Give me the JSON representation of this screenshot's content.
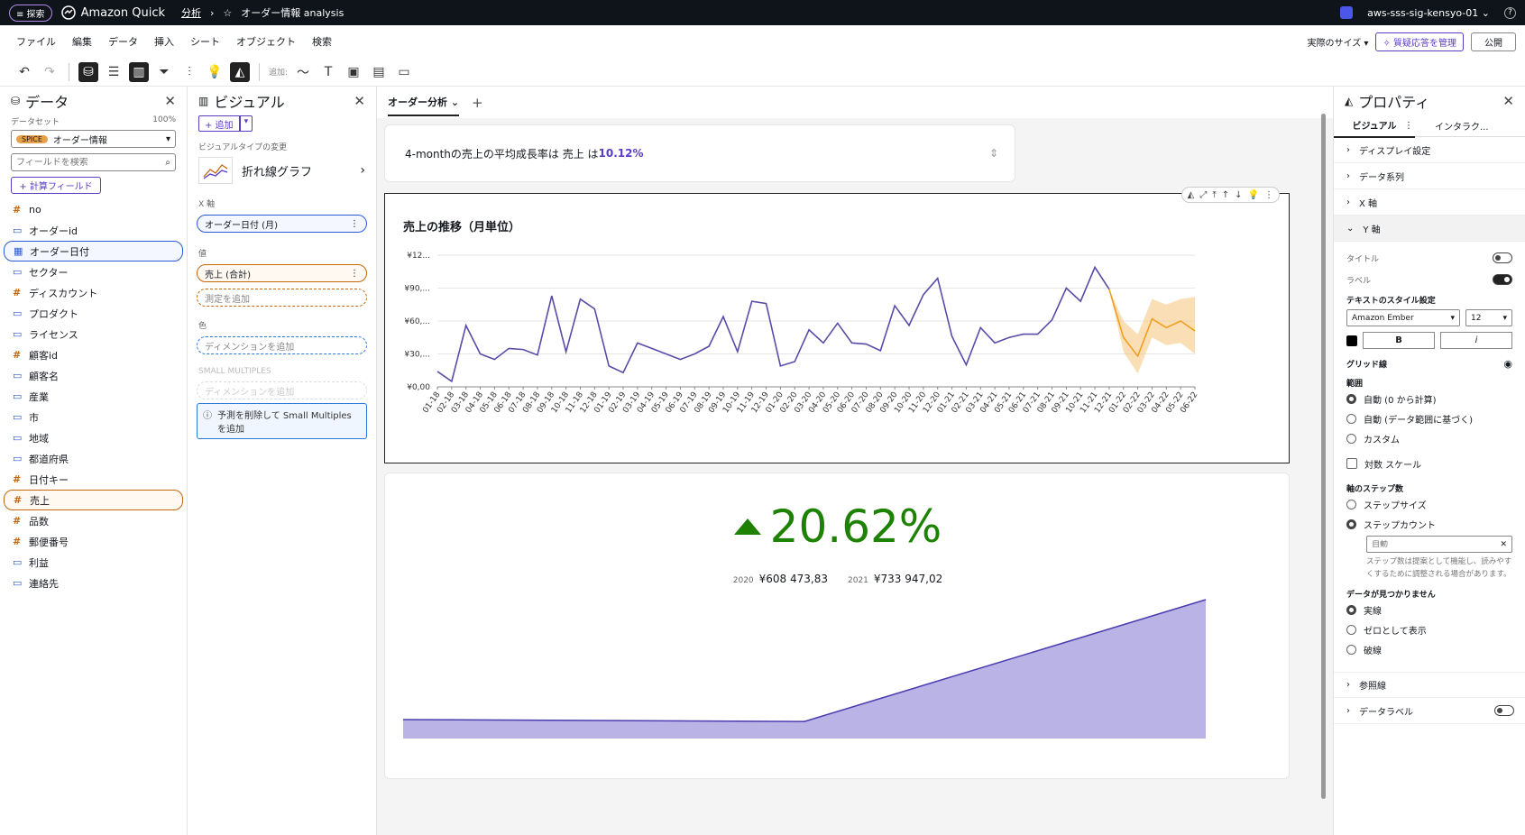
{
  "topbar": {
    "explore": "≡ 探索",
    "app": "Amazon Quick",
    "crumb1": "分析",
    "crumb2": "オーダー情報 analysis",
    "account": "aws-sss-sig-kensyo-01 ⌄",
    "help": "?"
  },
  "menu": [
    "ファイル",
    "編集",
    "データ",
    "挿入",
    "シート",
    "オブジェクト",
    "検索"
  ],
  "menu_right": {
    "size": "実際のサイズ ▾",
    "qa": "✧ 質疑応答を管理",
    "publish": "公開"
  },
  "toolbar": {
    "add_label": "追加:"
  },
  "data_panel": {
    "title": "データ",
    "dataset_label": "データセット",
    "dataset_pct": "100%",
    "spice": "SPICE",
    "dataset": "オーダー情報",
    "search_placeholder": "フィールドを検索",
    "calc_btn": "+ 計算フィールド",
    "fields": [
      {
        "icon": "#",
        "name": "no"
      },
      {
        "icon": "▭",
        "name": "オーダーid"
      },
      {
        "icon": "▦",
        "name": "オーダー日付"
      },
      {
        "icon": "▭",
        "name": "セクター"
      },
      {
        "icon": "#",
        "name": "ディスカウント"
      },
      {
        "icon": "▭",
        "name": "プロダクト"
      },
      {
        "icon": "▭",
        "name": "ライセンス"
      },
      {
        "icon": "#",
        "name": "顧客id"
      },
      {
        "icon": "▭",
        "name": "顧客名"
      },
      {
        "icon": "▭",
        "name": "産業"
      },
      {
        "icon": "▭",
        "name": "市"
      },
      {
        "icon": "▭",
        "name": "地域"
      },
      {
        "icon": "▭",
        "name": "都道府県"
      },
      {
        "icon": "#",
        "name": "日付キー"
      },
      {
        "icon": "#",
        "name": "売上"
      },
      {
        "icon": "#",
        "name": "品数"
      },
      {
        "icon": "#",
        "name": "郵便番号"
      },
      {
        "icon": "▭",
        "name": "利益"
      },
      {
        "icon": "▭",
        "name": "連絡先"
      }
    ]
  },
  "visual_panel": {
    "title": "ビジュアル",
    "add": "+ 追加",
    "type_label": "ビジュアルタイプの変更",
    "type": "折れ線グラフ",
    "x_label": "X 軸",
    "x_field": "オーダー日付 (月)",
    "value_label": "値",
    "value_field": "売上 (合計)",
    "add_measure": "測定を追加",
    "color_label": "色",
    "add_dim": "ディメンションを追加",
    "sm_label": "SMALL MULTIPLES",
    "sm_dim": "ディメンションを追加",
    "info": "予測を削除して Small Multiples を追加"
  },
  "sheet": {
    "tab": "オーダー分析 ⌄",
    "add": "+"
  },
  "insight": {
    "prefix": "4-monthの売上の平均成長率は 売上 は",
    "value": "10.12%"
  },
  "kpi": {
    "value": "20.62%",
    "y1": "2020",
    "v1": "¥608 473,83",
    "y2": "2021",
    "v2": "¥733 947,02"
  },
  "chart_data": {
    "type": "line",
    "title": "売上の推移（月単位）",
    "y_ticks": [
      "¥0,00",
      "¥30,...",
      "¥60,...",
      "¥90,...",
      "¥12..."
    ],
    "ylim": [
      0,
      120
    ],
    "categories": [
      "01-18",
      "02-18",
      "03-18",
      "04-18",
      "05-18",
      "06-18",
      "07-18",
      "08-18",
      "09-18",
      "10-18",
      "11-18",
      "12-18",
      "01-19",
      "02-19",
      "03-19",
      "04-19",
      "05-19",
      "06-19",
      "07-19",
      "08-19",
      "09-19",
      "10-19",
      "11-19",
      "12-19",
      "01-20",
      "02-20",
      "03-20",
      "04-20",
      "05-20",
      "06-20",
      "07-20",
      "08-20",
      "09-20",
      "10-20",
      "11-20",
      "12-20",
      "01-21",
      "02-21",
      "03-21",
      "04-21",
      "05-21",
      "06-21",
      "07-21",
      "08-21",
      "09-21",
      "10-21",
      "11-21",
      "12-21",
      "01-22",
      "02-22",
      "03-22",
      "04-22",
      "05-22",
      "06-22"
    ],
    "series": [
      {
        "values": [
          14,
          5,
          56,
          30,
          25,
          35,
          34,
          29,
          83,
          32,
          80,
          71,
          19,
          13,
          40,
          35,
          30,
          25,
          30,
          37,
          64,
          32,
          78,
          76,
          19,
          23,
          52,
          40,
          58,
          40,
          39,
          33,
          74,
          56,
          84,
          99,
          46,
          20,
          54,
          40,
          45,
          48,
          48,
          61,
          90,
          78,
          109,
          89,
          null,
          null,
          null,
          null,
          null,
          null
        ]
      },
      {
        "values": [
          null,
          null,
          null,
          null,
          null,
          null,
          null,
          null,
          null,
          null,
          null,
          null,
          null,
          null,
          null,
          null,
          null,
          null,
          null,
          null,
          null,
          null,
          null,
          null,
          null,
          null,
          null,
          null,
          null,
          null,
          null,
          null,
          null,
          null,
          null,
          null,
          null,
          null,
          null,
          null,
          null,
          null,
          null,
          null,
          null,
          null,
          null,
          89,
          45,
          28,
          62,
          54,
          60,
          51
        ]
      }
    ],
    "band_upper": [
      89,
      60,
      48,
      80,
      75,
      80,
      82
    ],
    "band_lower": [
      89,
      32,
      12,
      45,
      38,
      40,
      30
    ]
  },
  "area_chart": {
    "type": "area",
    "values": [
      100000,
      90000,
      733947
    ]
  },
  "props": {
    "title": "プロパティ",
    "tab1": "ビジュアル",
    "tab2": "インタラク...",
    "sections": [
      "ディスプレイ設定",
      "データ系列",
      "X 軸"
    ],
    "y_axis": "Y 軸",
    "title_row": "タイトル",
    "label_row": "ラベル",
    "text_style": "テキストのスタイル設定",
    "font": "Amazon Ember",
    "size": "12",
    "bold": "B",
    "italic": "i",
    "grid": "グリッド線",
    "range": "範囲",
    "range_opts": [
      "自動 (0 から計算)",
      "自動 (データ範囲に基づく)",
      "カスタム"
    ],
    "log": "対数 スケール",
    "steps": "軸のステップ数",
    "step_opts": [
      "ステップサイズ",
      "ステップカウント"
    ],
    "auto_placeholder": "自動",
    "step_note": "ステップ数は提案として機能し、読みやすくするために調整される場合があります。",
    "missing": "データが見つかりません",
    "missing_opts": [
      "実線",
      "ゼロとして表示",
      "破線"
    ],
    "ref": "参照線",
    "datalabel": "データラベル"
  }
}
